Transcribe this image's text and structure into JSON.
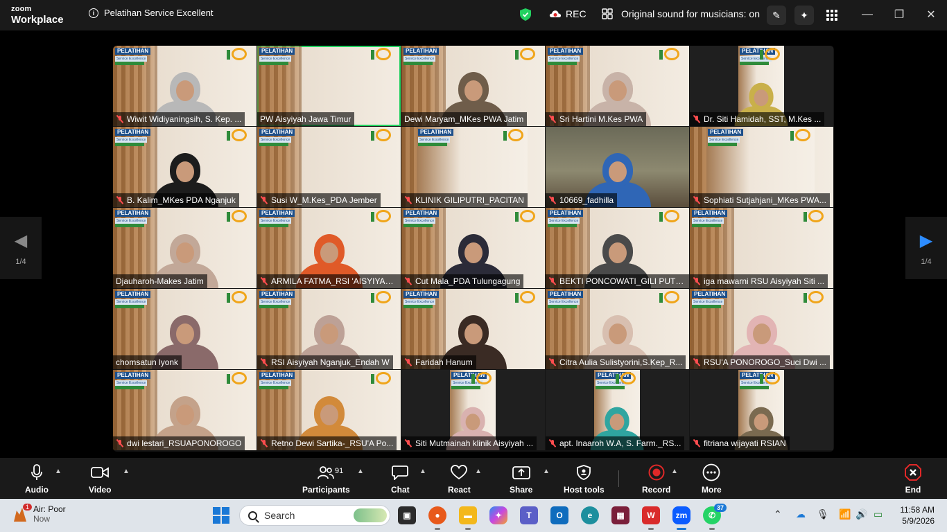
{
  "titlebar": {
    "brand_top": "zoom",
    "brand_bottom": "Workplace",
    "meeting_title": "Pelatihan Service Excellent",
    "rec_label": "REC",
    "sound_label": "Original sound for musicians: on"
  },
  "gallery": {
    "page_left": "1/4",
    "page_right": "1/4",
    "participants": [
      {
        "name": "Wiwit Widiyaningsih, S. Kep. ...",
        "muted": true
      },
      {
        "name": "PW Aisyiyah Jawa Timur",
        "muted": false
      },
      {
        "name": "Dewi Maryam_MKes PWA Jatim",
        "muted": false
      },
      {
        "name": "Sri Hartini M.Kes PWA",
        "muted": true
      },
      {
        "name": "Dr. Siti Hamidah, SST, M.Kes ...",
        "muted": true
      },
      {
        "name": "B. Kalim_MKes PDA Nganjuk",
        "muted": true
      },
      {
        "name": "Susi W_M.Kes_PDA Jember",
        "muted": true
      },
      {
        "name": "KLINIK GILIPUTRI_PACITAN",
        "muted": true
      },
      {
        "name": "10669_fadhilla",
        "muted": true
      },
      {
        "name": "Sophiati Sutjahjani_MKes PWA...",
        "muted": true
      },
      {
        "name": "Djauharoh-Makes Jatim",
        "muted": false
      },
      {
        "name": "ARMILA FATMA_RSI 'AISYIYAH ...",
        "muted": true
      },
      {
        "name": "Cut Mala_PDA Tulungagung",
        "muted": true
      },
      {
        "name": "BEKTI PONCOWATI_GILI PUTRI...",
        "muted": true
      },
      {
        "name": "iga mawarni RSU Aisyiyah Siti ...",
        "muted": true
      },
      {
        "name": "chomsatun lyonk",
        "muted": false
      },
      {
        "name": "RSI Aisyiyah Nganjuk_Endah W",
        "muted": true
      },
      {
        "name": "Faridah Hanum",
        "muted": true
      },
      {
        "name": "Citra Aulia Sulistyorini,S.Kep_R...",
        "muted": true
      },
      {
        "name": "RSU'A PONOROGO_Suci Dwi ...",
        "muted": true
      },
      {
        "name": "dwi lestari_RSUAPONOROGO",
        "muted": true
      },
      {
        "name": "Retno Dewi Sartika-_RSU'A Po...",
        "muted": true
      },
      {
        "name": "Siti Mutmainah klinik Aisyiyah ...",
        "muted": true
      },
      {
        "name": "apt. Inaaroh W.A, S. Farm._RS...",
        "muted": true
      },
      {
        "name": "fitriana wijayati RSIAN",
        "muted": true
      }
    ],
    "banner": {
      "title": "PELATIHAN",
      "subtitle": "Service Excellence"
    }
  },
  "toolbar": {
    "audio": "Audio",
    "video": "Video",
    "participants": "Participants",
    "participants_count": "91",
    "chat": "Chat",
    "react": "React",
    "share": "Share",
    "host_tools": "Host tools",
    "record": "Record",
    "more": "More",
    "end": "End"
  },
  "taskbar": {
    "weather_title": "Air: Poor",
    "weather_sub": "Now",
    "weather_badge": "1",
    "search_placeholder": "Search",
    "whatsapp_badge": "37",
    "time": "11:58 AM",
    "date": "5/9/2026"
  },
  "colors": {
    "accent_blue": "#2d8cff",
    "active_green": "#23d160",
    "muted_red": "#ff4d4f",
    "end_red": "#e02828"
  }
}
